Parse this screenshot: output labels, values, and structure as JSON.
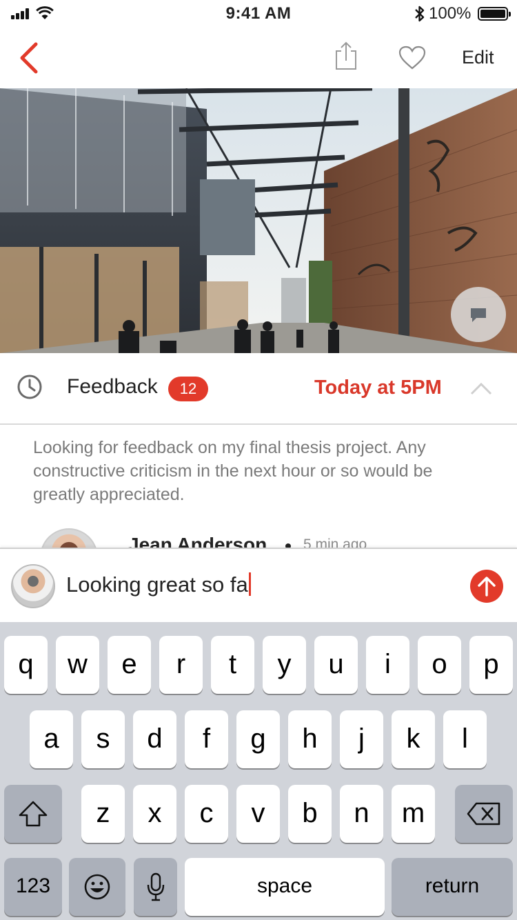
{
  "status_bar": {
    "time": "9:41 AM",
    "battery": "100%"
  },
  "nav": {
    "edit_label": "Edit"
  },
  "feedback": {
    "label": "Feedback",
    "count": "12",
    "due": "Today at 5PM",
    "description": "Looking for feedback on my final thesis project. Any constructive criticism in the next hour or so would be greatly appreciated."
  },
  "comment_preview": {
    "author": "Jean Anderson",
    "time": "5 min ago"
  },
  "composer": {
    "text": "Looking great so fa"
  },
  "keyboard": {
    "row1": [
      "q",
      "w",
      "e",
      "r",
      "t",
      "y",
      "u",
      "i",
      "o",
      "p"
    ],
    "row2": [
      "a",
      "s",
      "d",
      "f",
      "g",
      "h",
      "j",
      "k",
      "l"
    ],
    "row3": [
      "z",
      "x",
      "c",
      "v",
      "b",
      "n",
      "m"
    ],
    "numbers_label": "123",
    "space_label": "space",
    "return_label": "return"
  },
  "colors": {
    "accent": "#e23a2a",
    "keyboard_bg": "#d1d4da"
  }
}
